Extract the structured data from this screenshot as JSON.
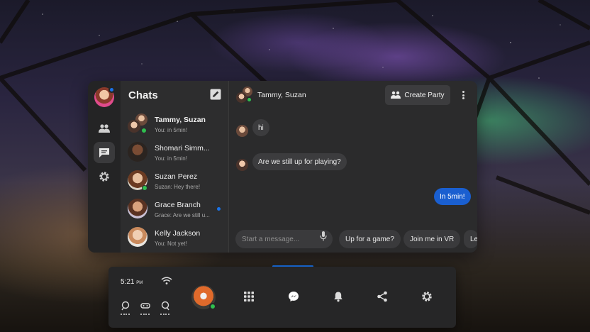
{
  "chat_panel": {
    "title": "Chats",
    "conversations": [
      {
        "name": "Tammy, Suzan",
        "preview": "You: in 5min!",
        "bold": true,
        "online": true,
        "unread": false
      },
      {
        "name": "Shomari Simm...",
        "preview": "You: in 5min!",
        "bold": false,
        "online": false,
        "unread": false
      },
      {
        "name": "Suzan Perez",
        "preview": "Suzan: Hey there!",
        "bold": false,
        "online": true,
        "unread": false
      },
      {
        "name": "Grace Branch",
        "preview": "Grace: Are we still u...",
        "bold": false,
        "online": false,
        "unread": true
      },
      {
        "name": "Kelly Jackson",
        "preview": "You: Not yet!",
        "bold": false,
        "online": false,
        "unread": false
      }
    ]
  },
  "conversation": {
    "title": "Tammy, Suzan",
    "create_party_label": "Create Party",
    "messages": [
      {
        "text": "hi",
        "direction": "in"
      },
      {
        "text": "Are we still up for playing?",
        "direction": "in"
      },
      {
        "text": "In 5min!",
        "direction": "out"
      }
    ],
    "input_placeholder": "Start a message...",
    "quick_replies": [
      "Up for a game?",
      "Join me in VR",
      "Le"
    ]
  },
  "taskbar": {
    "time": "5:21",
    "ampm": "PM",
    "icons": [
      "apps-grid-icon",
      "messenger-icon",
      "bell-icon",
      "share-icon",
      "settings-icon"
    ]
  },
  "colors": {
    "accent": "#1a73e8",
    "panel_bg": "#2b2b2c",
    "online": "#2fbf4f",
    "outgoing_bubble": "#1a5fd0"
  }
}
